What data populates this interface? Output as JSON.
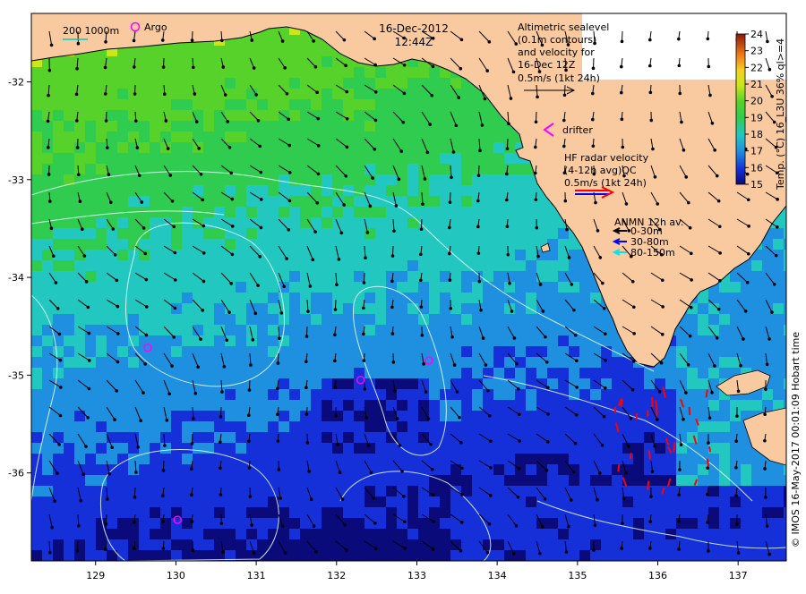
{
  "header": {
    "date": "16-Dec-2012",
    "time": "12:44Z"
  },
  "legend": {
    "scale_label": "200  1000m",
    "argo_label": "Argo",
    "altimetry_lines": [
      "Altimetric sealevel",
      "(0.1m contours)",
      "and velocity for",
      "16-Dec 12Z"
    ],
    "altimetry_scale": "0.5m/s (1kt 24h)",
    "drifter_label": "drifter",
    "hf_lines": [
      "HF radar velocity",
      "(4-12h avg)QC"
    ],
    "hf_scale": "0.5m/s (1kt 24h)",
    "anmn_title": "ANMN 12h av.",
    "anmn_items": [
      {
        "label": "0-30m",
        "color": "#000000"
      },
      {
        "label": "30-80m",
        "color": "#0000ff"
      },
      {
        "label": "80-150m",
        "color": "#00e5ee"
      }
    ]
  },
  "colorbar": {
    "label": "Temp. (°C) 16_L3U 36% ql>=4",
    "min": 15,
    "max": 24,
    "ticks": [
      "15",
      "16",
      "17",
      "18",
      "19",
      "20",
      "21",
      "22",
      "23",
      "24"
    ]
  },
  "credit": "© IMOS 16-May-2017 00:01:09 Hobart time",
  "axes": {
    "x_ticks": [
      "129",
      "130",
      "131",
      "132",
      "133",
      "134",
      "135",
      "136",
      "137"
    ],
    "y_ticks": [
      "-32",
      "-33",
      "-34",
      "-35",
      "-36"
    ],
    "lon_range": [
      128.2,
      137.6
    ],
    "lat_range": [
      -36.9,
      -31.3
    ]
  },
  "argo_floats": [
    {
      "lon": 129.65,
      "lat": -34.72
    },
    {
      "lon": 132.3,
      "lat": -35.05
    },
    {
      "lon": 133.15,
      "lat": -34.85
    },
    {
      "lon": 130.02,
      "lat": -36.48
    }
  ],
  "colors": {
    "land": "#f9c9a0",
    "argo": "#ff00ff",
    "hf_radar": "#ff0000",
    "drifter": "#ff00ff"
  }
}
